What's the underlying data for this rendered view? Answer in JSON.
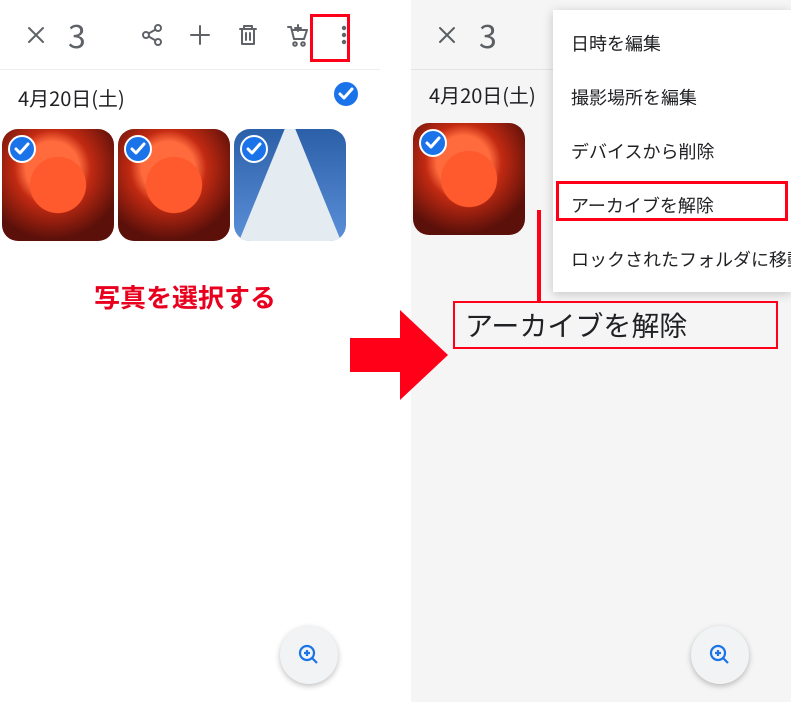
{
  "left": {
    "selected_count": "3",
    "date_label": "4月20日(土)",
    "annotation": "写真を選択する"
  },
  "right": {
    "selected_count": "3",
    "date_label": "4月20日(土)",
    "menu_items": [
      "日時を編集",
      "撮影場所を編集",
      "デバイスから削除",
      "アーカイブを解除",
      "ロックされたフォルダに移動"
    ],
    "callout": "アーカイブを解除"
  },
  "icons": {
    "close": "close-icon",
    "share": "share-icon",
    "plus": "plus-icon",
    "trash": "trash-icon",
    "cart": "cart-icon",
    "more": "more-vert-icon",
    "zoom": "zoom-in-icon",
    "check": "check-icon"
  }
}
